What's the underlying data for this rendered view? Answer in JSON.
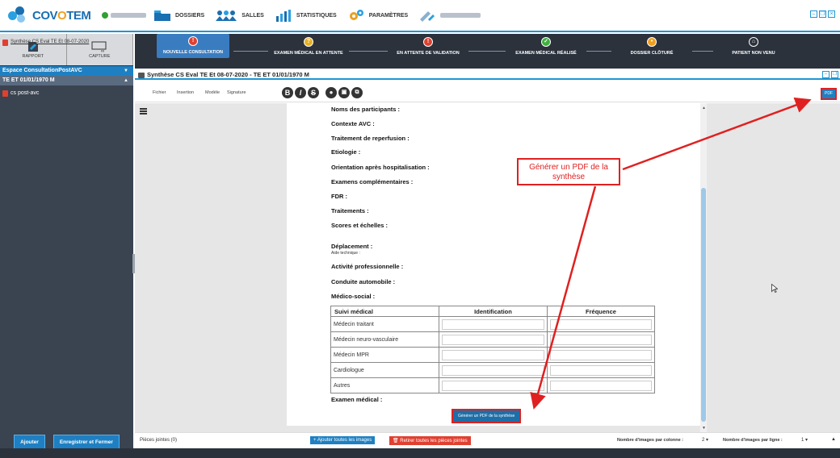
{
  "app": {
    "logo_part1": "COV",
    "logo_part2": "O",
    "logo_part3": "TEM"
  },
  "menu": [
    {
      "label": "DOSSIERS"
    },
    {
      "label": "SALLES"
    },
    {
      "label": "STATISTIQUES"
    },
    {
      "label": "PARAMÈTRES"
    }
  ],
  "left": {
    "rapport": "RAPPORT",
    "capture": "CAPTURE",
    "section1": "Espace ConsultationPostAVC",
    "section2": "TE ET 01/01/1970 M",
    "docs": [
      "cs post-avc",
      "Synthèse CS Eval TE Et 08-07-2020"
    ],
    "ajouter": "Ajouter",
    "enregistrer": "Enregistrer et Fermer"
  },
  "workflow": [
    {
      "label": "NOUVELLE CONSULTATION",
      "color": "#e04030",
      "glyph": "!"
    },
    {
      "label": "EXAMEN MÉDICAL EN ATTENTE",
      "color": "#e8b020",
      "glyph": "?"
    },
    {
      "label": "EN ATTENTE DE VALIDATION",
      "color": "#e04030",
      "glyph": "!"
    },
    {
      "label": "EXAMEN MÉDICAL RÉALISÉ",
      "color": "#40b040",
      "glyph": "✓"
    },
    {
      "label": "DOSSIER CLÔTURÉ",
      "color": "#f0a020",
      "glyph": "•"
    },
    {
      "label": "PATIENT NON VENU",
      "color": "#2b323c",
      "glyph": "⌂"
    }
  ],
  "doc": {
    "title": "Synthèse CS Eval TE Et 08-07-2020 - TE ET 01/01/1970 M"
  },
  "editor": {
    "tabs": [
      "Fichier",
      "Insertion",
      "Modèle",
      "Signature"
    ],
    "fmt": [
      "B",
      "I",
      "S"
    ],
    "pdf": "PDF"
  },
  "fields": [
    "Noms des participants :",
    "Contexte AVC :",
    "Traitement de reperfusion :",
    "Etiologie :",
    "Orientation après hospitalisation :",
    "Examens complémentaires :",
    "FDR :",
    "Traitements :",
    "Scores et échelles :",
    "Déplacement :",
    "Activité professionnelle :",
    "Conduite automobile :",
    "Médico-social :"
  ],
  "deplacement_sub": "Aide technique :",
  "table": {
    "headers": [
      "Suivi médical",
      "Identification",
      "Fréquence"
    ],
    "rows": [
      "Médecin traitant",
      "Médecin neuro-vasculaire",
      "Médecin MPR",
      "Cardiologue",
      "Autres"
    ]
  },
  "examen": "Examen médical :",
  "gen_button": "Générer un PDF de la synthèse",
  "callout": "Générer un PDF de la synthèse",
  "bottom": {
    "pj": "Pièces jointes (0)",
    "add_all": "Ajouter toutes les images",
    "remove_all": "Retirer toutes les pièces jointes",
    "nb_col_label": "Nombre d'images par colonne :",
    "nb_col": "2",
    "nb_line_label": "Nombre d'images par ligne :",
    "nb_line": "1"
  },
  "colors": {
    "accent": "#1e96d3",
    "dark": "#2b323c",
    "red": "#e02020"
  }
}
